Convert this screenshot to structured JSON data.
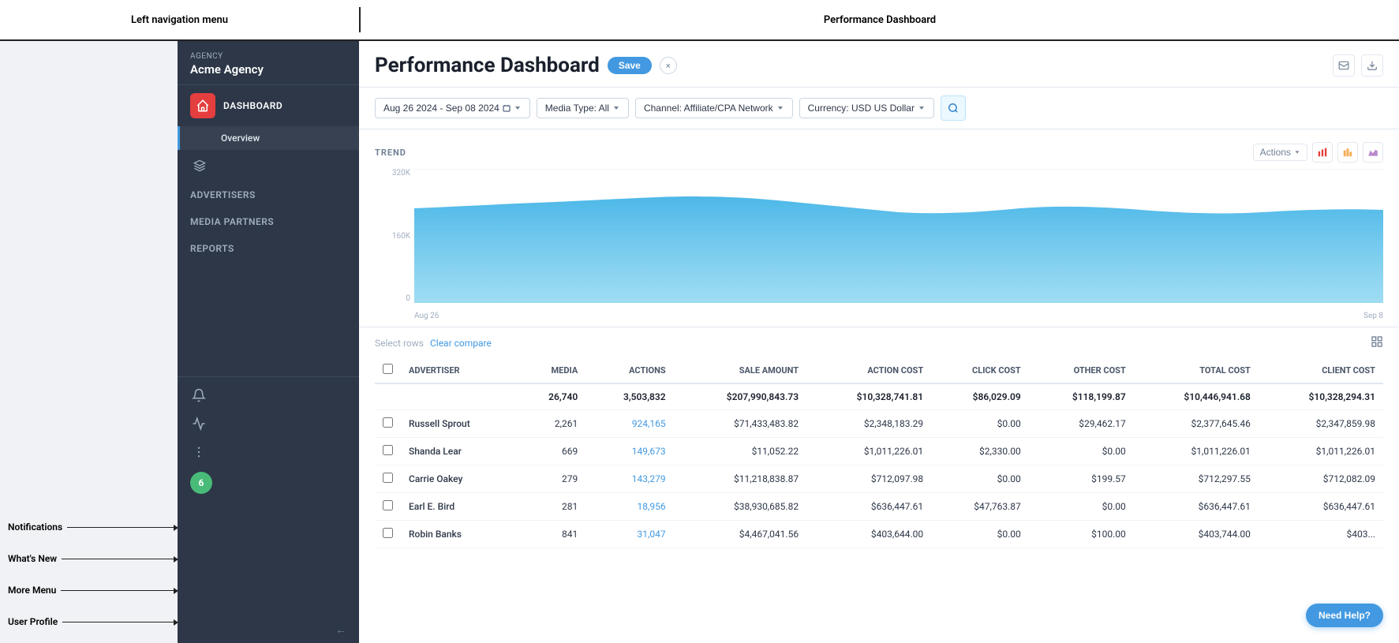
{
  "annotation": {
    "left_label": "Left navigation menu",
    "right_label": "Performance Dashboard",
    "bottom_labels": [
      "Notifications",
      "What's New",
      "More Menu",
      "User Profile"
    ]
  },
  "sidebar": {
    "agency_label": "Acme Agency",
    "agency_sublabel": "Agency",
    "nav_items": [
      {
        "label": "DASHBOARD",
        "icon": "dashboard-icon",
        "active": true
      },
      {
        "label": "Overview",
        "sub": true
      },
      {
        "label": "",
        "icon": "affiliates-icon"
      },
      {
        "label": "ADVERTISERS"
      },
      {
        "label": "MEDIA PARTNERS"
      },
      {
        "label": "REPORTS"
      }
    ]
  },
  "dashboard": {
    "title": "Performance Dashboard",
    "save_label": "Save",
    "close_label": "×"
  },
  "filters": {
    "date_range": "Aug 26 2024 - Sep 08 2024",
    "media_type": "Media Type: All",
    "channel": "Channel: Affiliate/CPA Network",
    "currency": "Currency: USD US Dollar"
  },
  "chart": {
    "title": "TREND",
    "y_labels": [
      "320K",
      "160K",
      "0"
    ],
    "x_labels": [
      "Aug 26",
      "Sep 8"
    ],
    "actions_label": "Actions"
  },
  "table": {
    "compare_label": "Select rows",
    "clear_compare": "Clear compare",
    "columns": [
      "",
      "ADVERTISER",
      "MEDIA",
      "ACTIONS",
      "SALE AMOUNT",
      "ACTION COST",
      "CLICK COST",
      "OTHER COST",
      "TOTAL COST",
      "CLIENT COST"
    ],
    "totals": {
      "media": "26,740",
      "actions": "3,503,832",
      "sale_amount": "$207,990,843.73",
      "action_cost": "$10,328,741.81",
      "click_cost": "$86,029.09",
      "other_cost": "$118,199.87",
      "total_cost": "$10,446,941.68",
      "client_cost": "$10,328,294.31"
    },
    "rows": [
      {
        "advertiser": "Russell Sprout",
        "media": "2,261",
        "actions": "924,165",
        "sale_amount": "$71,433,483.82",
        "action_cost": "$2,348,183.29",
        "click_cost": "$0.00",
        "other_cost": "$29,462.17",
        "total_cost": "$2,377,645.46",
        "client_cost": "$2,347,859.98"
      },
      {
        "advertiser": "Shanda Lear",
        "media": "669",
        "actions": "149,673",
        "sale_amount": "$11,052.22",
        "action_cost": "$1,011,226.01",
        "click_cost": "$2,330.00",
        "other_cost": "$0.00",
        "total_cost": "$1,011,226.01",
        "client_cost": "$1,011,226.01"
      },
      {
        "advertiser": "Carrie Oakey",
        "media": "279",
        "actions": "143,279",
        "sale_amount": "$11,218,838.87",
        "action_cost": "$712,097.98",
        "click_cost": "$0.00",
        "other_cost": "$199.57",
        "total_cost": "$712,297.55",
        "client_cost": "$712,082.09"
      },
      {
        "advertiser": "Earl E. Bird",
        "media": "281",
        "actions": "18,956",
        "sale_amount": "$38,930,685.82",
        "action_cost": "$636,447.61",
        "click_cost": "$47,763.87",
        "other_cost": "$0.00",
        "total_cost": "$636,447.61",
        "client_cost": "$636,447.61"
      },
      {
        "advertiser": "Robin Banks",
        "media": "841",
        "actions": "31,047",
        "sale_amount": "$4,467,041.56",
        "action_cost": "$403,644.00",
        "click_cost": "$0.00",
        "other_cost": "$100.00",
        "total_cost": "$403,744.00",
        "client_cost": "$403..."
      }
    ]
  },
  "help_btn": "Need Help?"
}
